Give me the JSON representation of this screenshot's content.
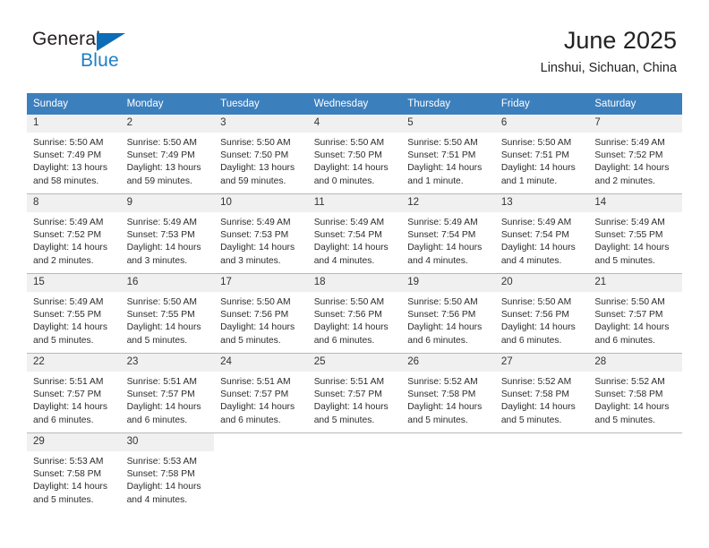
{
  "brand": {
    "name_part1": "General",
    "name_part2": "Blue",
    "triangle_color": "#0b6cb7",
    "blue_color": "#1f7fc4"
  },
  "header": {
    "title": "June 2025",
    "location": "Linshui, Sichuan, China"
  },
  "theme": {
    "header_bg": "#3c7fbd",
    "header_text": "#ffffff",
    "daynum_bg": "#f0f0f0",
    "grid_line": "#b9b9b9"
  },
  "weekdays": [
    "Sunday",
    "Monday",
    "Tuesday",
    "Wednesday",
    "Thursday",
    "Friday",
    "Saturday"
  ],
  "days": [
    {
      "day": "1",
      "sunrise": "Sunrise: 5:50 AM",
      "sunset": "Sunset: 7:49 PM",
      "daylight_line1": "Daylight: 13 hours",
      "daylight_line2": "and 58 minutes."
    },
    {
      "day": "2",
      "sunrise": "Sunrise: 5:50 AM",
      "sunset": "Sunset: 7:49 PM",
      "daylight_line1": "Daylight: 13 hours",
      "daylight_line2": "and 59 minutes."
    },
    {
      "day": "3",
      "sunrise": "Sunrise: 5:50 AM",
      "sunset": "Sunset: 7:50 PM",
      "daylight_line1": "Daylight: 13 hours",
      "daylight_line2": "and 59 minutes."
    },
    {
      "day": "4",
      "sunrise": "Sunrise: 5:50 AM",
      "sunset": "Sunset: 7:50 PM",
      "daylight_line1": "Daylight: 14 hours",
      "daylight_line2": "and 0 minutes."
    },
    {
      "day": "5",
      "sunrise": "Sunrise: 5:50 AM",
      "sunset": "Sunset: 7:51 PM",
      "daylight_line1": "Daylight: 14 hours",
      "daylight_line2": "and 1 minute."
    },
    {
      "day": "6",
      "sunrise": "Sunrise: 5:50 AM",
      "sunset": "Sunset: 7:51 PM",
      "daylight_line1": "Daylight: 14 hours",
      "daylight_line2": "and 1 minute."
    },
    {
      "day": "7",
      "sunrise": "Sunrise: 5:49 AM",
      "sunset": "Sunset: 7:52 PM",
      "daylight_line1": "Daylight: 14 hours",
      "daylight_line2": "and 2 minutes."
    },
    {
      "day": "8",
      "sunrise": "Sunrise: 5:49 AM",
      "sunset": "Sunset: 7:52 PM",
      "daylight_line1": "Daylight: 14 hours",
      "daylight_line2": "and 2 minutes."
    },
    {
      "day": "9",
      "sunrise": "Sunrise: 5:49 AM",
      "sunset": "Sunset: 7:53 PM",
      "daylight_line1": "Daylight: 14 hours",
      "daylight_line2": "and 3 minutes."
    },
    {
      "day": "10",
      "sunrise": "Sunrise: 5:49 AM",
      "sunset": "Sunset: 7:53 PM",
      "daylight_line1": "Daylight: 14 hours",
      "daylight_line2": "and 3 minutes."
    },
    {
      "day": "11",
      "sunrise": "Sunrise: 5:49 AM",
      "sunset": "Sunset: 7:54 PM",
      "daylight_line1": "Daylight: 14 hours",
      "daylight_line2": "and 4 minutes."
    },
    {
      "day": "12",
      "sunrise": "Sunrise: 5:49 AM",
      "sunset": "Sunset: 7:54 PM",
      "daylight_line1": "Daylight: 14 hours",
      "daylight_line2": "and 4 minutes."
    },
    {
      "day": "13",
      "sunrise": "Sunrise: 5:49 AM",
      "sunset": "Sunset: 7:54 PM",
      "daylight_line1": "Daylight: 14 hours",
      "daylight_line2": "and 4 minutes."
    },
    {
      "day": "14",
      "sunrise": "Sunrise: 5:49 AM",
      "sunset": "Sunset: 7:55 PM",
      "daylight_line1": "Daylight: 14 hours",
      "daylight_line2": "and 5 minutes."
    },
    {
      "day": "15",
      "sunrise": "Sunrise: 5:49 AM",
      "sunset": "Sunset: 7:55 PM",
      "daylight_line1": "Daylight: 14 hours",
      "daylight_line2": "and 5 minutes."
    },
    {
      "day": "16",
      "sunrise": "Sunrise: 5:50 AM",
      "sunset": "Sunset: 7:55 PM",
      "daylight_line1": "Daylight: 14 hours",
      "daylight_line2": "and 5 minutes."
    },
    {
      "day": "17",
      "sunrise": "Sunrise: 5:50 AM",
      "sunset": "Sunset: 7:56 PM",
      "daylight_line1": "Daylight: 14 hours",
      "daylight_line2": "and 5 minutes."
    },
    {
      "day": "18",
      "sunrise": "Sunrise: 5:50 AM",
      "sunset": "Sunset: 7:56 PM",
      "daylight_line1": "Daylight: 14 hours",
      "daylight_line2": "and 6 minutes."
    },
    {
      "day": "19",
      "sunrise": "Sunrise: 5:50 AM",
      "sunset": "Sunset: 7:56 PM",
      "daylight_line1": "Daylight: 14 hours",
      "daylight_line2": "and 6 minutes."
    },
    {
      "day": "20",
      "sunrise": "Sunrise: 5:50 AM",
      "sunset": "Sunset: 7:56 PM",
      "daylight_line1": "Daylight: 14 hours",
      "daylight_line2": "and 6 minutes."
    },
    {
      "day": "21",
      "sunrise": "Sunrise: 5:50 AM",
      "sunset": "Sunset: 7:57 PM",
      "daylight_line1": "Daylight: 14 hours",
      "daylight_line2": "and 6 minutes."
    },
    {
      "day": "22",
      "sunrise": "Sunrise: 5:51 AM",
      "sunset": "Sunset: 7:57 PM",
      "daylight_line1": "Daylight: 14 hours",
      "daylight_line2": "and 6 minutes."
    },
    {
      "day": "23",
      "sunrise": "Sunrise: 5:51 AM",
      "sunset": "Sunset: 7:57 PM",
      "daylight_line1": "Daylight: 14 hours",
      "daylight_line2": "and 6 minutes."
    },
    {
      "day": "24",
      "sunrise": "Sunrise: 5:51 AM",
      "sunset": "Sunset: 7:57 PM",
      "daylight_line1": "Daylight: 14 hours",
      "daylight_line2": "and 6 minutes."
    },
    {
      "day": "25",
      "sunrise": "Sunrise: 5:51 AM",
      "sunset": "Sunset: 7:57 PM",
      "daylight_line1": "Daylight: 14 hours",
      "daylight_line2": "and 5 minutes."
    },
    {
      "day": "26",
      "sunrise": "Sunrise: 5:52 AM",
      "sunset": "Sunset: 7:58 PM",
      "daylight_line1": "Daylight: 14 hours",
      "daylight_line2": "and 5 minutes."
    },
    {
      "day": "27",
      "sunrise": "Sunrise: 5:52 AM",
      "sunset": "Sunset: 7:58 PM",
      "daylight_line1": "Daylight: 14 hours",
      "daylight_line2": "and 5 minutes."
    },
    {
      "day": "28",
      "sunrise": "Sunrise: 5:52 AM",
      "sunset": "Sunset: 7:58 PM",
      "daylight_line1": "Daylight: 14 hours",
      "daylight_line2": "and 5 minutes."
    },
    {
      "day": "29",
      "sunrise": "Sunrise: 5:53 AM",
      "sunset": "Sunset: 7:58 PM",
      "daylight_line1": "Daylight: 14 hours",
      "daylight_line2": "and 5 minutes."
    },
    {
      "day": "30",
      "sunrise": "Sunrise: 5:53 AM",
      "sunset": "Sunset: 7:58 PM",
      "daylight_line1": "Daylight: 14 hours",
      "daylight_line2": "and 4 minutes."
    }
  ]
}
